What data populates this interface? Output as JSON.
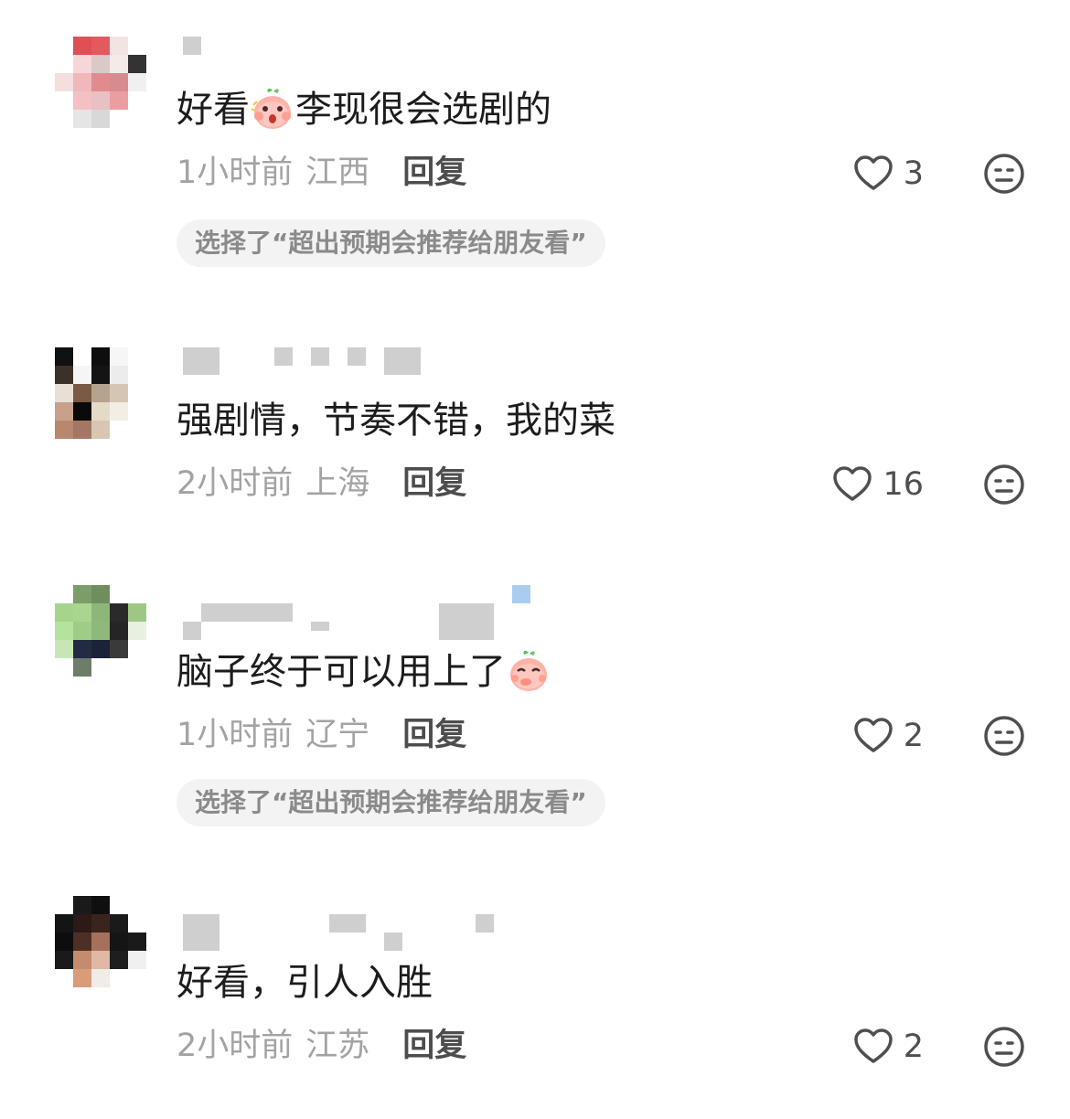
{
  "comments": [
    {
      "text": "好看",
      "text_after_emoji": "李现很会选剧的",
      "emoji": "peach-surprised-emoji",
      "time": "1小时前",
      "location": "江西",
      "reply_label": "回复",
      "like_count": "3",
      "tag": "选择了“超出预期会推荐给朋友看”"
    },
    {
      "text": "强剧情，节奏不错，我的菜",
      "time": "2小时前",
      "location": "上海",
      "reply_label": "回复",
      "like_count": "16"
    },
    {
      "text": "脑子终于可以用上了",
      "emoji": "peach-giggle-emoji",
      "time": "1小时前",
      "location": "辽宁",
      "reply_label": "回复",
      "like_count": "2",
      "tag": "选择了“超出预期会推荐给朋友看”"
    },
    {
      "text": "好看，引人入胜",
      "time": "2小时前",
      "location": "江苏",
      "reply_label": "回复",
      "like_count": "2"
    }
  ],
  "icons": {
    "like": "heart-outline-icon",
    "dislike": "meh-face-icon"
  },
  "colors": {
    "text": "#1c1c1c",
    "meta": "#a3a3a3",
    "reply": "#4d4d4d",
    "tag_bg": "#f3f3f3",
    "tag_text": "#8a8a8a",
    "icon": "#4f4f4f"
  }
}
